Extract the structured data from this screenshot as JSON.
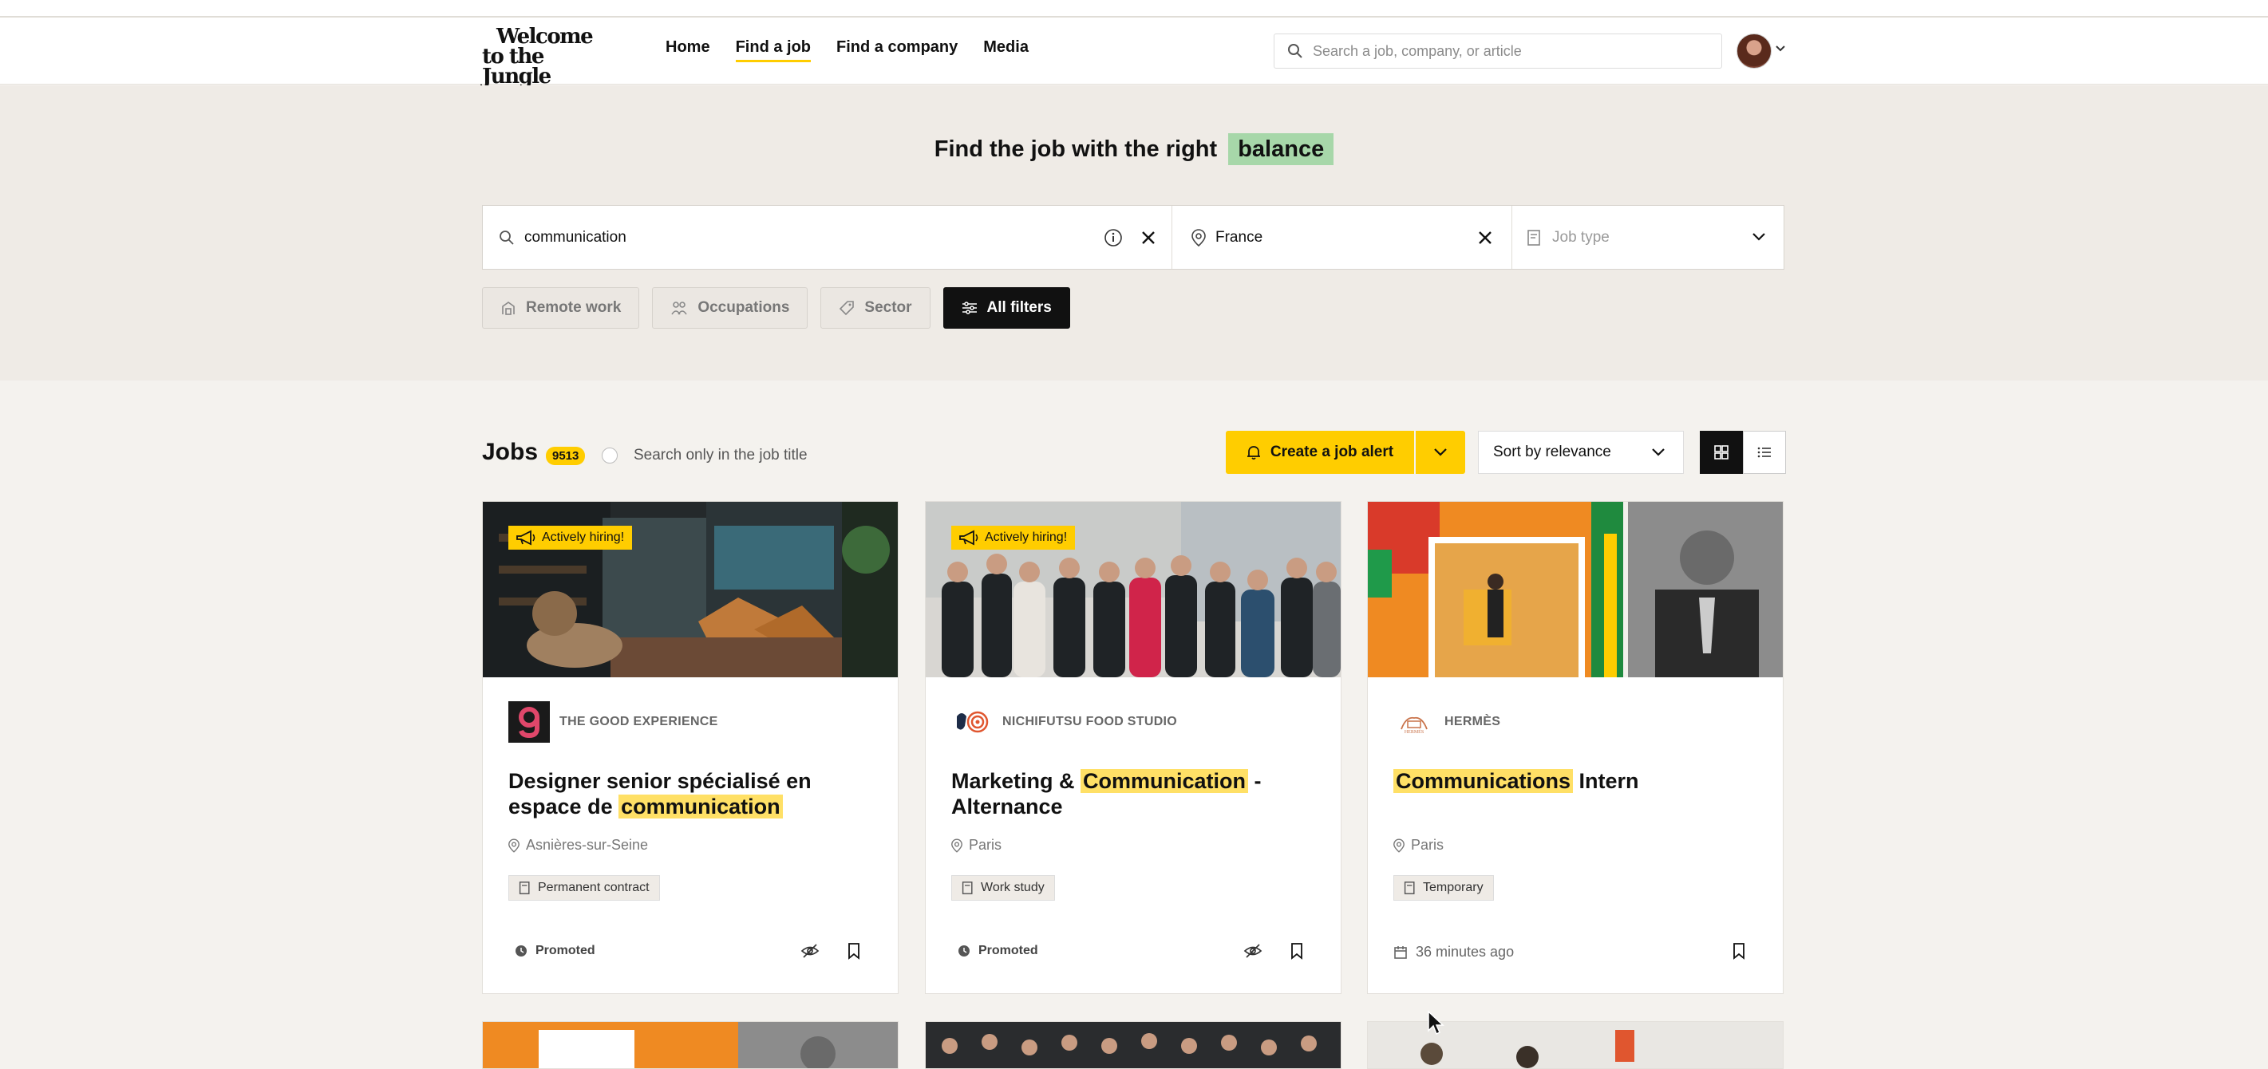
{
  "header": {
    "logo_line1": "Welcome",
    "logo_line2": "to the Jungle",
    "nav": [
      "Home",
      "Find a job",
      "Find a company",
      "Media"
    ],
    "active_nav": "Find a job",
    "search_placeholder": "Search a job, company, or article"
  },
  "hero": {
    "title": "Find the job with the right",
    "highlight": "balance",
    "query": "communication",
    "location": "France",
    "job_type_placeholder": "Job type",
    "filters": [
      "Remote work",
      "Occupations",
      "Sector",
      "All filters"
    ]
  },
  "jobs": {
    "title": "Jobs",
    "count": "9513",
    "title_only_label": "Search only in the job title",
    "alert_label": "Create a job alert",
    "sort_label": "Sort by relevance"
  },
  "cards": [
    {
      "badge": "Actively hiring!",
      "company": "THE GOOD EXPERIENCE",
      "title_pre": "Designer senior spécialisé en espace de ",
      "title_mark": "communication",
      "title_post": "",
      "location": "Asnières-sur-Seine",
      "contract": "Permanent contract",
      "footer": "Promoted"
    },
    {
      "badge": "Actively hiring!",
      "company": "NICHIFUTSU FOOD STUDIO",
      "title_pre": "Marketing & ",
      "title_mark": "Communication",
      "title_post": " - Alternance",
      "location": "Paris",
      "contract": "Work study",
      "footer": "Promoted"
    },
    {
      "badge": "",
      "company": "HERMÈS",
      "title_pre": "",
      "title_mark": "Communications",
      "title_post": " Intern",
      "location": "Paris",
      "contract": "Temporary",
      "footer": "36 minutes ago"
    }
  ],
  "colors": {
    "accent": "#ffcd00",
    "highlight_green": "#a7d7a9",
    "hero_bg": "#efebe6"
  },
  "icons": [
    "search-icon",
    "info-icon",
    "close-icon",
    "pin-icon",
    "chevron-down-icon",
    "bell-icon",
    "grid-icon",
    "list-icon",
    "bookmark-icon",
    "hide-icon",
    "megaphone-icon",
    "calendar-icon"
  ]
}
